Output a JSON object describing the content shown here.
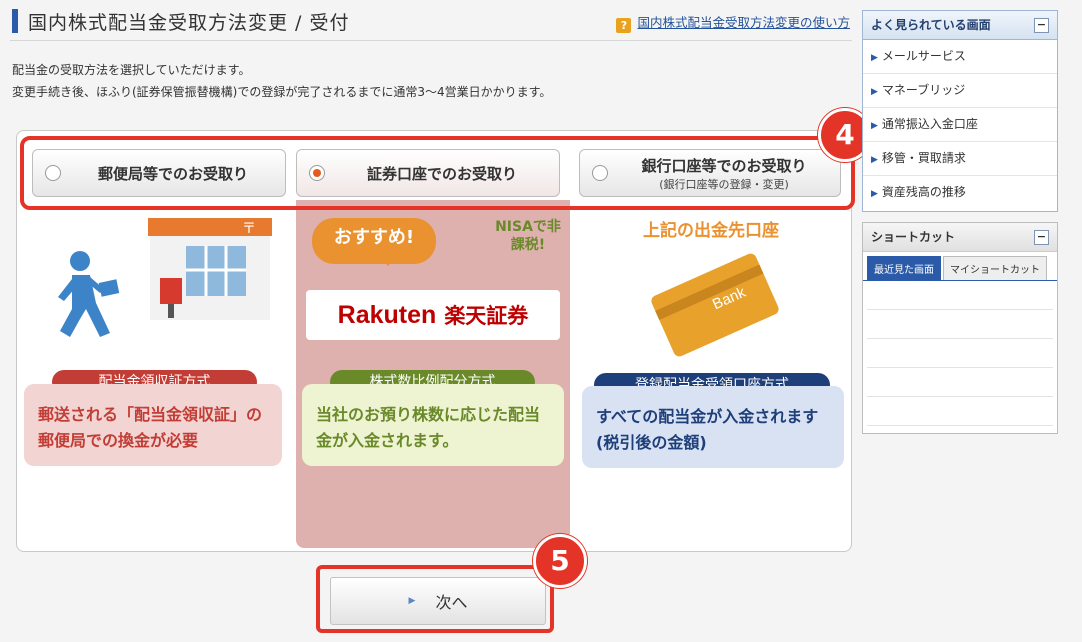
{
  "header": {
    "title": "国内株式配当金受取方法変更 / 受付",
    "help_link": "国内株式配当金受取方法変更の使い方",
    "help_icon": "?"
  },
  "description": {
    "line1": "配当金の受取方法を選択していただけます。",
    "line2": "変更手続き後、ほふり(証券保管振替機構)での登録が完了されるまでに通常3〜4営業日かかります。"
  },
  "options": [
    {
      "label": "郵便局等でのお受取り",
      "selected": false,
      "method_pill": "配当金領収証方式",
      "method_desc": "郵送される「配当金領収証」の郵便局での換金が必要"
    },
    {
      "label": "証券口座でのお受取り",
      "selected": true,
      "bubble": "おすすめ!",
      "nisa": "NISAで非課税!",
      "logo_latin": "Rakuten",
      "logo_jp": "楽天証券",
      "method_pill": "株式数比例配分方式",
      "method_desc": "当社のお預り株数に応じた配当金が入金されます。"
    },
    {
      "label": "銀行口座等でのお受取り",
      "sublabel": "(銀行口座等の登録・変更)",
      "selected": false,
      "top_text": "上記の出金先口座",
      "card_text": "Bank",
      "method_pill": "登録配当金受領口座方式",
      "method_desc": "すべての配当金が入金されます(税引後の金額)"
    }
  ],
  "badges": {
    "step4": "4",
    "step5": "5"
  },
  "next_button": "次へ",
  "sidebar": {
    "popular_title": "よく見られている画面",
    "popular_items": [
      "メールサービス",
      "マネーブリッジ",
      "通常振込入金口座",
      "移管・買取請求",
      "資産残高の推移"
    ],
    "shortcut_title": "ショートカット",
    "shortcut_tabs": [
      "最近見た画面",
      "マイショートカット"
    ],
    "collapse_symbol": "−"
  },
  "colors": {
    "accent_red": "#e43428",
    "brand_blue": "#2a5aa8",
    "rakuten_red": "#bf0000",
    "pill_red": "#c23d36",
    "pill_green": "#6a8a2a",
    "pill_navy": "#1f3f7a"
  }
}
